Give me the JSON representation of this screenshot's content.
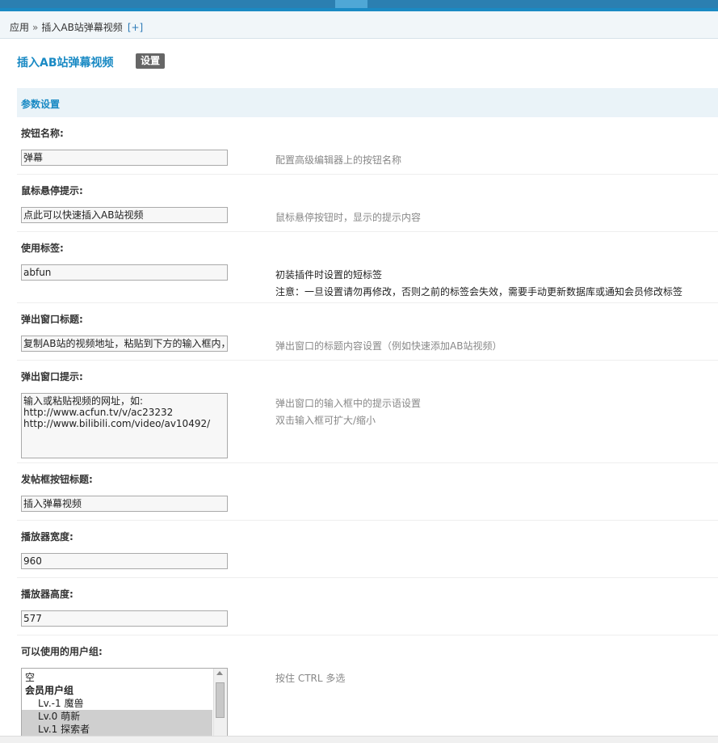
{
  "breadcrumb": {
    "root": "应用",
    "sep": "»",
    "current": "插入AB站弹幕视频",
    "plus": "[+]"
  },
  "page_title": "插入AB站弹幕视频",
  "tab_label": "设置",
  "section_title": "参数设置",
  "fields": {
    "button_name": {
      "label": "按钮名称:",
      "value": "弹幕",
      "hint": "配置高级编辑器上的按钮名称"
    },
    "hover_tip": {
      "label": "鼠标悬停提示:",
      "value": "点此可以快速插入AB站视频",
      "hint": "鼠标悬停按钮时，显示的提示内容"
    },
    "tag": {
      "label": "使用标签:",
      "value": "abfun",
      "hint1": "初装插件时设置的短标签",
      "hint2": "注意：一旦设置请勿再修改，否则之前的标签会失效，需要手动更新数据库或通知会员修改标签"
    },
    "popup_title": {
      "label": "弹出窗口标题:",
      "value": "复制AB站的视频地址，粘贴到下方的输入框内，",
      "hint": "弹出窗口的标题内容设置（例如快速添加AB站视频）"
    },
    "popup_prompt": {
      "label": "弹出窗口提示:",
      "value": "输入或粘贴视频的网址，如:\nhttp://www.acfun.tv/v/ac23232\nhttp://www.bilibili.com/video/av10492/",
      "hint1": "弹出窗口的输入框中的提示语设置",
      "hint2": "双击输入框可扩大/缩小"
    },
    "post_button_title": {
      "label": "发帖框按钮标题:",
      "value": "插入弹幕视频"
    },
    "player_width": {
      "label": "播放器宽度:",
      "value": "960"
    },
    "player_height": {
      "label": "播放器高度:",
      "value": "577"
    },
    "user_groups": {
      "label": "可以使用的用户组:",
      "hint": "按住 CTRL 多选",
      "options": [
        {
          "text": "空",
          "kind": "plain"
        },
        {
          "text": "会员用户组",
          "kind": "group"
        },
        {
          "text": "Lv.-1 魔兽",
          "kind": "sub"
        },
        {
          "text": "Lv.0 萌新",
          "kind": "sub-sel"
        },
        {
          "text": "Lv.1 探索者",
          "kind": "sub-sel"
        }
      ]
    }
  }
}
